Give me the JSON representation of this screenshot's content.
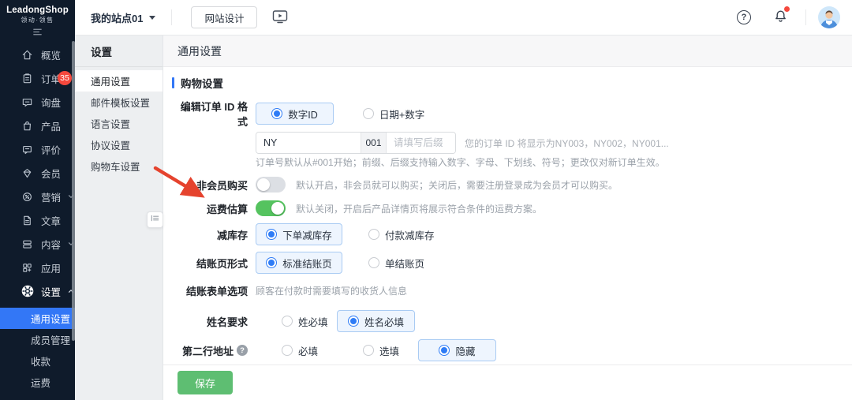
{
  "colors": {
    "accent_blue": "#3377f6",
    "toggle_green": "#55c35f",
    "save_green": "#5ebe72",
    "badge_red": "#f5483d",
    "arrow_red": "#e5432e",
    "sidebar_dark": "#0f1b2b"
  },
  "brand": {
    "name": "LeadongShop",
    "tagline": "领动·领售"
  },
  "topbar": {
    "site_selector": "我的站点01",
    "design_button": "网站设计"
  },
  "icons": {
    "help_glyph": "?",
    "field_help_glyph": "?"
  },
  "sidebar": {
    "items": [
      {
        "label": "概览"
      },
      {
        "label": "订单",
        "badge": "35"
      },
      {
        "label": "询盘"
      },
      {
        "label": "产品"
      },
      {
        "label": "评价"
      },
      {
        "label": "会员"
      },
      {
        "label": "营销"
      },
      {
        "label": "文章"
      },
      {
        "label": "内容"
      },
      {
        "label": "应用"
      },
      {
        "label": "设置"
      }
    ],
    "submenu": [
      {
        "label": "通用设置"
      },
      {
        "label": "成员管理"
      },
      {
        "label": "收款"
      },
      {
        "label": "运费"
      }
    ]
  },
  "settings_nav": {
    "title": "设置",
    "items": [
      {
        "label": "通用设置"
      },
      {
        "label": "邮件模板设置"
      },
      {
        "label": "语言设置"
      },
      {
        "label": "协议设置"
      },
      {
        "label": "购物车设置"
      }
    ]
  },
  "main": {
    "page_title": "通用设置",
    "section_title": "购物设置",
    "order_id": {
      "label": "编辑订单 ID 格式",
      "options": [
        "数字ID",
        "日期+数字"
      ],
      "prefix_value": "NY",
      "number_value": "001",
      "suffix_placeholder": "请填写后缀",
      "inline_hint": "您的订单 ID 将显示为NY003，NY002，NY001...",
      "hint": "订单号默认从#001开始；前缀、后缀支持输入数字、字母、下划线、符号；更改仅对新订单生效。"
    },
    "guest_buy": {
      "label": "非会员购买",
      "hint": "默认开启，非会员就可以购买；关闭后，需要注册登录成为会员才可以购买。"
    },
    "shipping_estimate": {
      "label": "运费估算",
      "hint": "默认关闭，开启后产品详情页将展示符合条件的运费方案。"
    },
    "stock": {
      "label": "减库存",
      "options": [
        "下单减库存",
        "付款减库存"
      ]
    },
    "checkout_page": {
      "label": "结账页形式",
      "options": [
        "标准结账页",
        "单结账页"
      ]
    },
    "checkout_form": {
      "label": "结账表单选项",
      "hint": "顾客在付款时需要填写的收货人信息"
    },
    "name_required": {
      "label": "姓名要求",
      "options": [
        "姓必填",
        "姓名必填"
      ]
    },
    "address_line2": {
      "label": "第二行地址",
      "options": [
        "必填",
        "选填",
        "隐藏"
      ]
    },
    "save_label": "保存"
  }
}
